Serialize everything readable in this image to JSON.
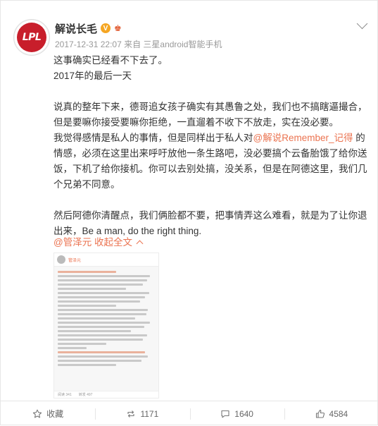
{
  "author": {
    "name": "解说长毛",
    "avatar_text": "LPL",
    "verified_badge": "V",
    "extra_badge": "♚",
    "meta": "2017-12-31 22:07 来自 三星android智能手机"
  },
  "post": {
    "p1": "这事确实已经看不下去了。",
    "p2": "2017年的最后一天",
    "p3": "说真的整年下来，德哥追女孩子确实有其愚鲁之处，我们也不搞瞎逼撮合，但是要嘛你接受要嘛你拒绝，一直遛着不收下不放走，实在没必要。",
    "p4_before": "我觉得感情是私人的事情，但是同样出于私人对",
    "p4_mention": "@解说Remember_记得",
    "p4_after": " 的情感，必须在这里出来呼吁放他一条生路吧，没必要搞个云备胎饿了给你送饭，下机了给你接机。你可以去别处搞，没关系，但是在阿德这里，我们几个兄弟不同意。",
    "p5": "然后阿德你清醒点，我们俩脸都不要，把事情弄这么难看，就是为了让你退出来，Be a man, do the right thing."
  },
  "links": {
    "mention": "@管泽元",
    "expand": "收起全文",
    "expand_icon": "chevron-up-icon"
  },
  "thumbnail": {
    "name": "管泽元",
    "footer_a": "阅读 341",
    "footer_b": "转发 497"
  },
  "footer": {
    "fav_label": "收藏",
    "repost_count": "1171",
    "comment_count": "1640",
    "like_count": "4584"
  },
  "colors": {
    "accent": "#eb7350",
    "avatar_red": "#c81e2b",
    "badge_gold": "#f5a623"
  }
}
